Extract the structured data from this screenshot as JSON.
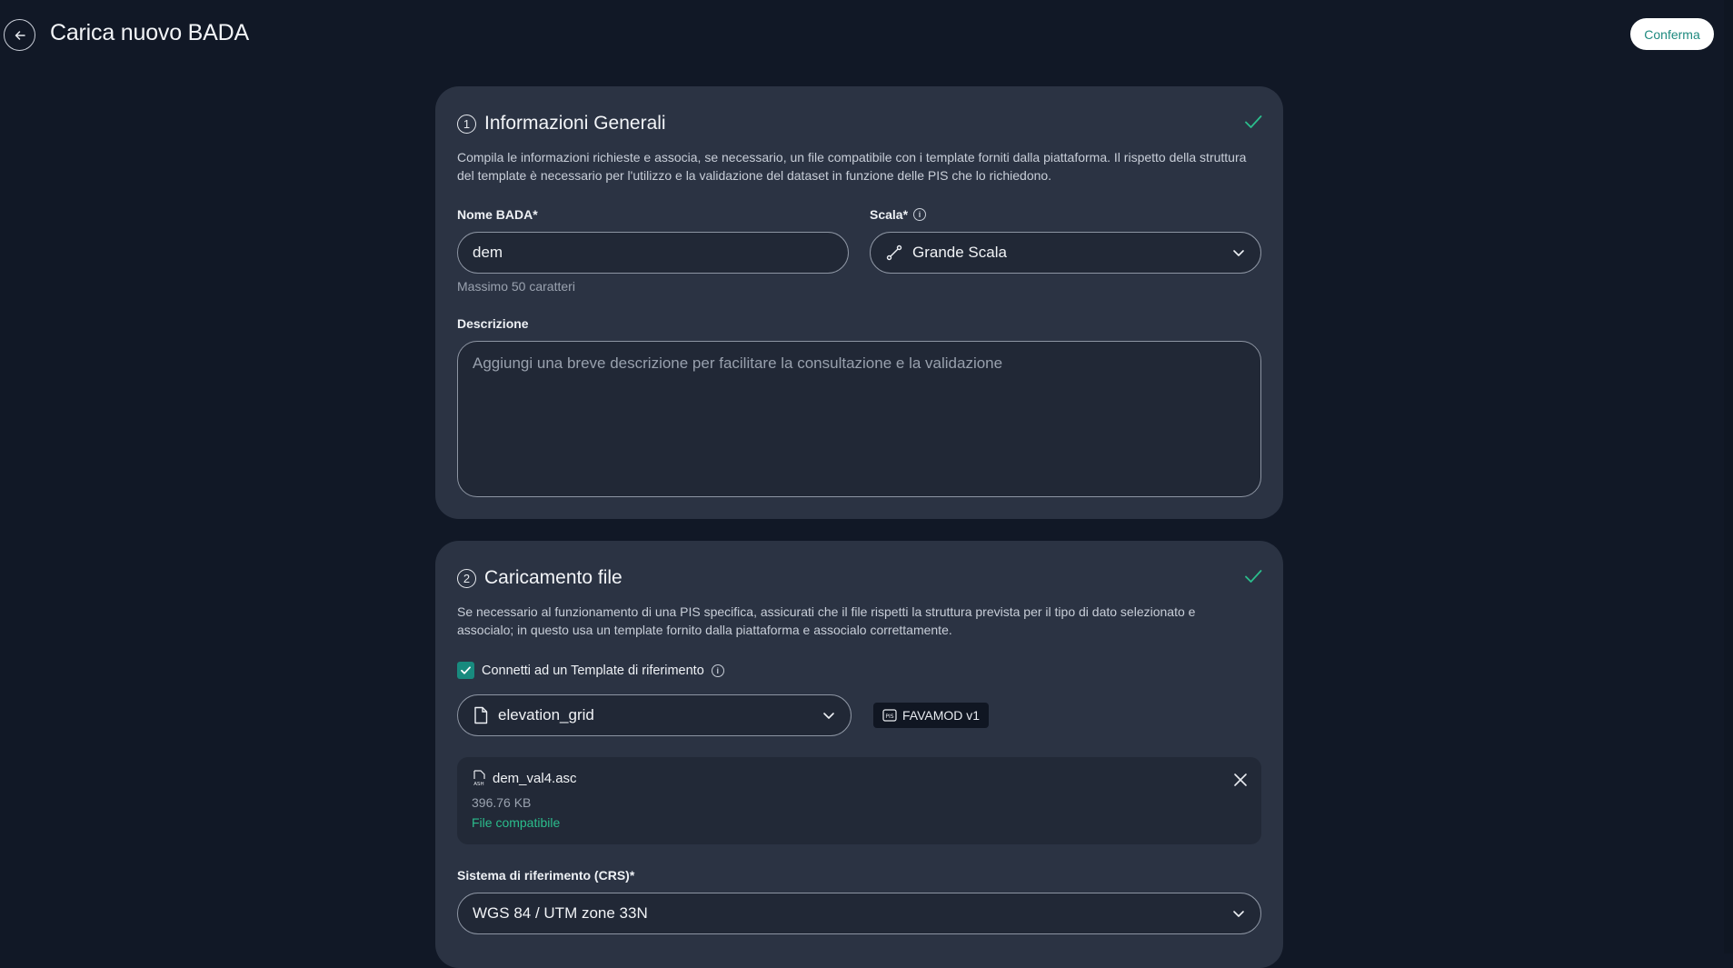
{
  "header": {
    "title": "Carica nuovo BADA",
    "confirm_label": "Conferma"
  },
  "section1": {
    "step": "1",
    "title": "Informazioni Generali",
    "description": "Compila le informazioni richieste e associa, se necessario, un file compatibile con i template forniti dalla piattaforma. Il rispetto della struttura del template è necessario per l'utilizzo e la validazione del dataset in funzione delle PIS che lo richiedono.",
    "name_label": "Nome BADA*",
    "name_value": "dem",
    "name_hint": "Massimo 50 caratteri",
    "scale_label": "Scala*",
    "scale_value": "Grande Scala",
    "description_label": "Descrizione",
    "description_placeholder": "Aggiungi una breve descrizione per facilitare la consultazione e la validazione"
  },
  "section2": {
    "step": "2",
    "title": "Caricamento file",
    "description": "Se necessario al funzionamento di una PIS specifica, assicurati che il file rispetti la struttura prevista per il tipo di dato selezionato e associalo; in questo usa un template fornito dalla piattaforma e associalo correttamente.",
    "template_checkbox_label": "Connetti ad un Template di riferimento",
    "template_checked": true,
    "template_value": "elevation_grid",
    "pis_badge": "FAVAMOD v1",
    "file": {
      "name": "dem_val4.asc",
      "size": "396.76 KB",
      "status": "File compatibile"
    },
    "crs_label": "Sistema di riferimento (CRS)*",
    "crs_value": "WGS 84 / UTM zone 33N"
  },
  "colors": {
    "background": "#111826",
    "card": "#2b3343",
    "accent": "#188a7e",
    "success": "#2bbd8c"
  }
}
